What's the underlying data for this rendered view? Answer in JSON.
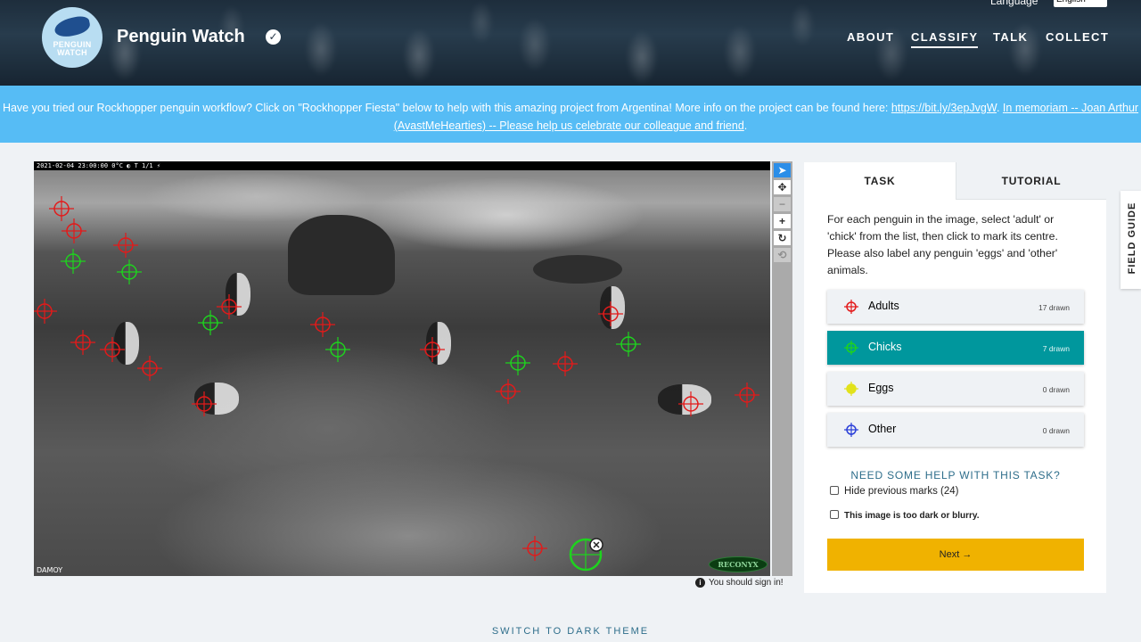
{
  "header": {
    "logo_text_line1": "PENGUIN",
    "logo_text_line2": "WATCH",
    "title": "Penguin Watch",
    "verified_icon": "check-circle-icon",
    "nav": [
      {
        "label": "ABOUT"
      },
      {
        "label": "CLASSIFY",
        "active": true
      },
      {
        "label": "TALK"
      },
      {
        "label": "COLLECT"
      }
    ],
    "language_label": "Language",
    "language_value": "English"
  },
  "banner": {
    "text_before": "Have you tried our Rockhopper penguin workflow? Click on \"Rockhopper Fiesta\" below to help with this amazing project from Argentina! More info on the project can be found here: ",
    "link1": "https://bit.ly/3epJvgW",
    "text_between": ". ",
    "link2": "In memoriam -- Joan Arthur (AvastMeHearties) -- Please help us celebrate our colleague and friend",
    "text_after": "."
  },
  "subject": {
    "timestamp": "2021-02-04 23:00:00     0°C ◐     T 1/1 ⚡",
    "camera_label": "DAMOY",
    "camera_brand": "RECONYX",
    "sign_in_notice": "You should sign in!"
  },
  "toolbar": {
    "tools": [
      "pointer-icon",
      "move-icon",
      "zoom-out-icon",
      "zoom-in-icon",
      "rotate-icon",
      "reset-icon"
    ]
  },
  "panel": {
    "tab_task": "TASK",
    "tab_tutorial": "TUTORIAL",
    "instructions": "For each penguin in the image, select 'adult' or 'chick' from the list, then click to mark its centre. Please also label any penguin 'eggs' and 'other' animals.",
    "tools": [
      {
        "label": "Adults",
        "count": "17 drawn",
        "color": "#e31a1a"
      },
      {
        "label": "Chicks",
        "count": "7 drawn",
        "color": "#1ed31e",
        "selected": true
      },
      {
        "label": "Eggs",
        "count": "0 drawn",
        "color": "#e2e21b"
      },
      {
        "label": "Other",
        "count": "0 drawn",
        "color": "#2a3fd8"
      }
    ],
    "help_link": "NEED SOME HELP WITH THIS TASK?",
    "hide_marks": "Hide previous marks (24)",
    "too_dark": "This image is too dark or blurry.",
    "next_button": "Next →"
  },
  "field_guide": "FIELD GUIDE",
  "dark_theme": "SWITCH TO DARK THEME",
  "colors": {
    "adult": "#e31a1a",
    "chick": "#1ed31e",
    "accent": "#00979d",
    "next": "#f0b200",
    "banner": "#56bcf5"
  }
}
